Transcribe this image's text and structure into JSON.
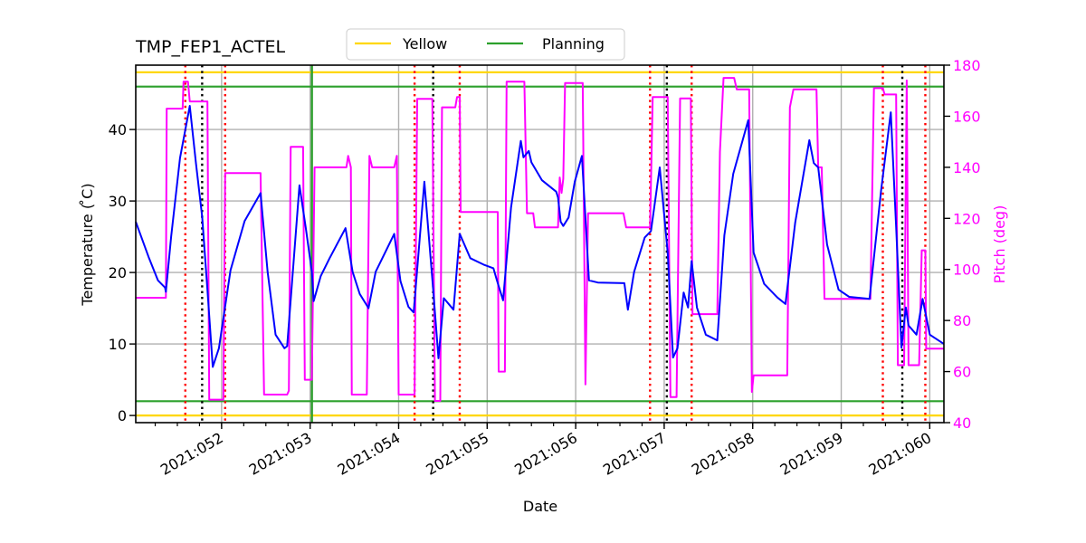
{
  "chart_data": {
    "type": "line",
    "title": "TMP_FEP1_ACTEL",
    "xlabel": "Date",
    "ylabel": "Temperature ($^\\circ$C)",
    "ylabel_display": "Temperature ( ̊C)",
    "y2label": "Pitch (deg)",
    "xlim": [
      51.03,
      60.16
    ],
    "ylim": [
      -1,
      49
    ],
    "y2lim": [
      40,
      180
    ],
    "grid": true,
    "legend": {
      "placement": "top-center",
      "entries": [
        {
          "label": "Yellow",
          "color": "#ffd700"
        },
        {
          "label": "Planning",
          "color": "#2ca02c"
        }
      ]
    },
    "x_ticks": [
      {
        "value": 52,
        "label": "2021:052"
      },
      {
        "value": 53,
        "label": "2021:053"
      },
      {
        "value": 54,
        "label": "2021:054"
      },
      {
        "value": 55,
        "label": "2021:055"
      },
      {
        "value": 56,
        "label": "2021:056"
      },
      {
        "value": 57,
        "label": "2021:057"
      },
      {
        "value": 58,
        "label": "2021:058"
      },
      {
        "value": 59,
        "label": "2021:059"
      },
      {
        "value": 60,
        "label": "2021:060"
      }
    ],
    "x_minor_step": 0.25,
    "y_ticks": [
      0,
      10,
      20,
      30,
      40
    ],
    "y2_ticks": [
      40,
      60,
      80,
      100,
      120,
      140,
      160,
      180
    ],
    "limit_lines": [
      {
        "name": "yellow-high",
        "value": 48,
        "color": "#ffd700"
      },
      {
        "name": "planning-high",
        "value": 46,
        "color": "#2ca02c"
      },
      {
        "name": "planning-low",
        "value": 2,
        "color": "#2ca02c"
      },
      {
        "name": "yellow-low",
        "value": 0,
        "color": "#ffd700"
      }
    ],
    "vertical_markers": [
      {
        "x": 51.59,
        "color": "#ff0000",
        "style": "dotted"
      },
      {
        "x": 51.78,
        "color": "#000000",
        "style": "dotted"
      },
      {
        "x": 52.04,
        "color": "#ff0000",
        "style": "dotted"
      },
      {
        "x": 53.02,
        "color": "#2ca02c",
        "style": "solid"
      },
      {
        "x": 54.18,
        "color": "#ff0000",
        "style": "dotted"
      },
      {
        "x": 54.39,
        "color": "#000000",
        "style": "dotted"
      },
      {
        "x": 54.69,
        "color": "#ff0000",
        "style": "dotted"
      },
      {
        "x": 56.84,
        "color": "#ff0000",
        "style": "dotted"
      },
      {
        "x": 57.03,
        "color": "#000000",
        "style": "dotted"
      },
      {
        "x": 57.31,
        "color": "#ff0000",
        "style": "dotted"
      },
      {
        "x": 59.47,
        "color": "#ff0000",
        "style": "dotted"
      },
      {
        "x": 59.69,
        "color": "#000000",
        "style": "dotted"
      },
      {
        "x": 59.95,
        "color": "#ff0000",
        "style": "dotted"
      }
    ],
    "series": [
      {
        "name": "Temperature",
        "axis": "left",
        "color": "#0000ff",
        "points": [
          [
            51.03,
            27.1
          ],
          [
            51.18,
            22.0
          ],
          [
            51.28,
            18.9
          ],
          [
            51.36,
            17.9
          ],
          [
            51.37,
            17.3
          ],
          [
            51.43,
            25.0
          ],
          [
            51.53,
            36.0
          ],
          [
            51.64,
            43.3
          ],
          [
            51.71,
            35.3
          ],
          [
            51.78,
            27.8
          ],
          [
            51.84,
            17.6
          ],
          [
            51.9,
            6.8
          ],
          [
            51.97,
            9.4
          ],
          [
            52.1,
            20.3
          ],
          [
            52.26,
            27.2
          ],
          [
            52.44,
            31.1
          ],
          [
            52.52,
            20.1
          ],
          [
            52.61,
            11.3
          ],
          [
            52.71,
            9.4
          ],
          [
            52.74,
            9.7
          ],
          [
            52.88,
            32.2
          ],
          [
            52.95,
            26.3
          ],
          [
            53.02,
            20.1
          ],
          [
            53.04,
            16.0
          ],
          [
            53.12,
            19.5
          ],
          [
            53.22,
            22.0
          ],
          [
            53.4,
            26.2
          ],
          [
            53.48,
            20.1
          ],
          [
            53.56,
            17.0
          ],
          [
            53.64,
            15.4
          ],
          [
            53.66,
            15.0
          ],
          [
            53.74,
            20.1
          ],
          [
            53.84,
            22.6
          ],
          [
            53.95,
            25.4
          ],
          [
            54.02,
            18.8
          ],
          [
            54.11,
            15.2
          ],
          [
            54.17,
            14.4
          ],
          [
            54.29,
            32.7
          ],
          [
            54.39,
            17.7
          ],
          [
            54.45,
            8.0
          ],
          [
            54.51,
            16.4
          ],
          [
            54.62,
            14.8
          ],
          [
            54.69,
            25.4
          ],
          [
            54.81,
            22.0
          ],
          [
            54.96,
            21.1
          ],
          [
            55.07,
            20.6
          ],
          [
            55.11,
            18.9
          ],
          [
            55.18,
            16.1
          ],
          [
            55.27,
            29.1
          ],
          [
            55.38,
            38.4
          ],
          [
            55.41,
            36.1
          ],
          [
            55.47,
            37.0
          ],
          [
            55.5,
            35.4
          ],
          [
            55.62,
            32.9
          ],
          [
            55.78,
            31.3
          ],
          [
            55.8,
            30.5
          ],
          [
            55.83,
            27.1
          ],
          [
            55.86,
            26.5
          ],
          [
            55.92,
            27.7
          ],
          [
            55.99,
            32.7
          ],
          [
            56.07,
            36.3
          ],
          [
            56.15,
            18.9
          ],
          [
            56.25,
            18.6
          ],
          [
            56.55,
            18.5
          ],
          [
            56.59,
            14.8
          ],
          [
            56.66,
            20.1
          ],
          [
            56.78,
            24.9
          ],
          [
            56.85,
            25.8
          ],
          [
            56.95,
            34.7
          ],
          [
            57.04,
            22.8
          ],
          [
            57.1,
            8.1
          ],
          [
            57.15,
            9.4
          ],
          [
            57.22,
            17.2
          ],
          [
            57.27,
            15.1
          ],
          [
            57.31,
            21.6
          ],
          [
            57.37,
            15.1
          ],
          [
            57.47,
            11.3
          ],
          [
            57.6,
            10.5
          ],
          [
            57.68,
            25.2
          ],
          [
            57.78,
            33.8
          ],
          [
            57.95,
            41.3
          ],
          [
            58.01,
            22.8
          ],
          [
            58.13,
            18.4
          ],
          [
            58.28,
            16.5
          ],
          [
            58.37,
            15.6
          ],
          [
            58.48,
            27.0
          ],
          [
            58.64,
            38.5
          ],
          [
            58.69,
            35.3
          ],
          [
            58.74,
            34.7
          ],
          [
            58.84,
            23.9
          ],
          [
            58.97,
            17.6
          ],
          [
            59.09,
            16.6
          ],
          [
            59.32,
            16.3
          ],
          [
            59.45,
            31.5
          ],
          [
            59.56,
            42.4
          ],
          [
            59.62,
            26.4
          ],
          [
            59.68,
            9.5
          ],
          [
            59.73,
            15.1
          ],
          [
            59.76,
            12.6
          ],
          [
            59.85,
            11.3
          ],
          [
            59.92,
            16.3
          ],
          [
            60.0,
            11.3
          ],
          [
            60.16,
            10.0
          ]
        ]
      },
      {
        "name": "Pitch",
        "axis": "right",
        "color": "#ff00ff",
        "points": [
          [
            51.03,
            88.9
          ],
          [
            51.37,
            88.9
          ],
          [
            51.38,
            163.0
          ],
          [
            51.56,
            163.0
          ],
          [
            51.57,
            173.5
          ],
          [
            51.62,
            173.5
          ],
          [
            51.64,
            165.8
          ],
          [
            51.84,
            165.8
          ],
          [
            51.86,
            49.0
          ],
          [
            52.02,
            49.0
          ],
          [
            52.04,
            137.7
          ],
          [
            52.44,
            137.7
          ],
          [
            52.48,
            51.0
          ],
          [
            52.74,
            51.0
          ],
          [
            52.76,
            52.5
          ],
          [
            52.78,
            148.0
          ],
          [
            52.92,
            148.0
          ],
          [
            52.94,
            56.8
          ],
          [
            53.02,
            56.8
          ],
          [
            53.05,
            140.0
          ],
          [
            53.41,
            140.0
          ],
          [
            53.43,
            144.5
          ],
          [
            53.46,
            140.0
          ],
          [
            53.47,
            51.0
          ],
          [
            53.64,
            51.0
          ],
          [
            53.67,
            144.5
          ],
          [
            53.7,
            140.0
          ],
          [
            53.95,
            140.0
          ],
          [
            53.98,
            144.5
          ],
          [
            54.0,
            51.0
          ],
          [
            54.18,
            51.0
          ],
          [
            54.21,
            166.8
          ],
          [
            54.38,
            166.8
          ],
          [
            54.41,
            48.5
          ],
          [
            54.47,
            48.5
          ],
          [
            54.49,
            163.5
          ],
          [
            54.64,
            163.5
          ],
          [
            54.66,
            167.5
          ],
          [
            54.69,
            167.5
          ],
          [
            54.7,
            122.5
          ],
          [
            55.12,
            122.5
          ],
          [
            55.13,
            60.0
          ],
          [
            55.2,
            60.0
          ],
          [
            55.22,
            173.5
          ],
          [
            55.42,
            173.5
          ],
          [
            55.45,
            122.0
          ],
          [
            55.52,
            122.0
          ],
          [
            55.54,
            116.5
          ],
          [
            55.8,
            116.5
          ],
          [
            55.82,
            136.0
          ],
          [
            55.84,
            130.0
          ],
          [
            55.86,
            135.5
          ],
          [
            55.88,
            173.0
          ],
          [
            56.08,
            173.0
          ],
          [
            56.11,
            55.0
          ],
          [
            56.14,
            122.0
          ],
          [
            56.54,
            122.0
          ],
          [
            56.57,
            116.5
          ],
          [
            56.84,
            116.5
          ],
          [
            56.87,
            167.5
          ],
          [
            57.04,
            167.5
          ],
          [
            57.07,
            50.0
          ],
          [
            57.14,
            50.0
          ],
          [
            57.18,
            167.0
          ],
          [
            57.3,
            167.0
          ],
          [
            57.32,
            82.5
          ],
          [
            57.6,
            82.5
          ],
          [
            57.63,
            146.0
          ],
          [
            57.67,
            175.0
          ],
          [
            57.79,
            175.0
          ],
          [
            57.82,
            170.5
          ],
          [
            57.96,
            170.5
          ],
          [
            57.99,
            52.0
          ],
          [
            58.01,
            58.5
          ],
          [
            58.39,
            58.5
          ],
          [
            58.42,
            163.5
          ],
          [
            58.46,
            170.5
          ],
          [
            58.72,
            170.5
          ],
          [
            58.74,
            140.0
          ],
          [
            58.78,
            140.0
          ],
          [
            58.81,
            88.5
          ],
          [
            59.33,
            88.5
          ],
          [
            59.37,
            171.0
          ],
          [
            59.47,
            171.0
          ],
          [
            59.49,
            168.5
          ],
          [
            59.62,
            168.5
          ],
          [
            59.64,
            62.5
          ],
          [
            59.71,
            62.5
          ],
          [
            59.74,
            174.0
          ],
          [
            59.76,
            62.5
          ],
          [
            59.88,
            62.5
          ],
          [
            59.91,
            107.5
          ],
          [
            59.95,
            107.5
          ],
          [
            59.96,
            69.0
          ],
          [
            60.16,
            69.0
          ]
        ]
      }
    ]
  }
}
